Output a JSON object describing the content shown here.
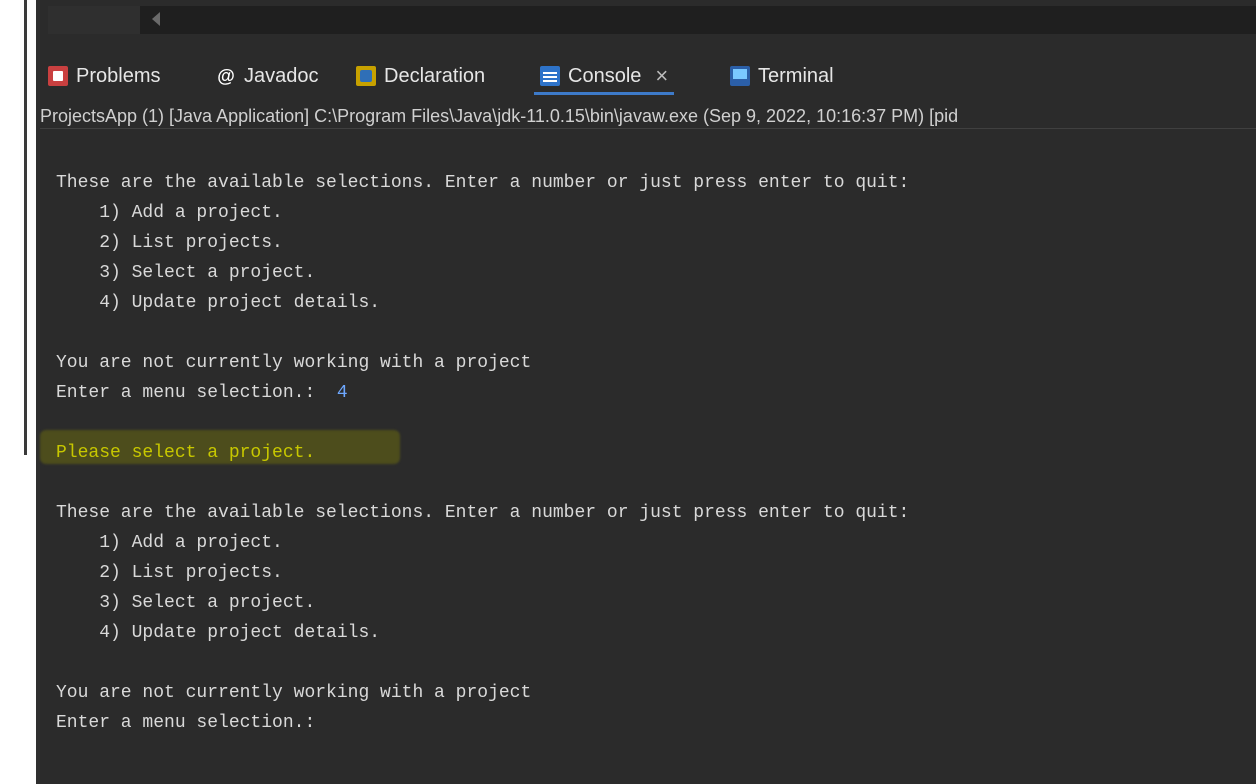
{
  "tabs": [
    {
      "label": "Problems",
      "icon": "problems-icon",
      "active": false
    },
    {
      "label": "Javadoc",
      "icon": "javadoc-icon",
      "active": false
    },
    {
      "label": "Declaration",
      "icon": "declaration-icon",
      "active": false
    },
    {
      "label": "Console",
      "icon": "console-icon",
      "active": true
    },
    {
      "label": "Terminal",
      "icon": "terminal-icon",
      "active": false
    }
  ],
  "launch_info": "ProjectsApp (1) [Java Application] C:\\Program Files\\Java\\jdk-11.0.15\\bin\\javaw.exe  (Sep 9, 2022, 10:16:37 PM) [pid",
  "console": {
    "block1": {
      "prompt": "These are the available selections. Enter a number or just press enter to quit:",
      "options": [
        "    1) Add a project.",
        "    2) List projects.",
        "    3) Select a project.",
        "    4) Update project details."
      ],
      "status": "You are not currently working with a project",
      "entry_label": "Enter a menu selection.:  ",
      "entry_value": "4"
    },
    "message": "Please select a project.",
    "block2": {
      "prompt": "These are the available selections. Enter a number or just press enter to quit:",
      "options": [
        "    1) Add a project.",
        "    2) List projects.",
        "    3) Select a project.",
        "    4) Update project details."
      ],
      "status": "You are not currently working with a project",
      "entry_label": "Enter a menu selection.:"
    }
  },
  "colors": {
    "background": "#2b2b2b",
    "console_text": "#d9d9d9",
    "input_value": "#6ea8ff",
    "highlight_text": "#e6e600",
    "active_tab_underline": "#3d7ac9"
  }
}
